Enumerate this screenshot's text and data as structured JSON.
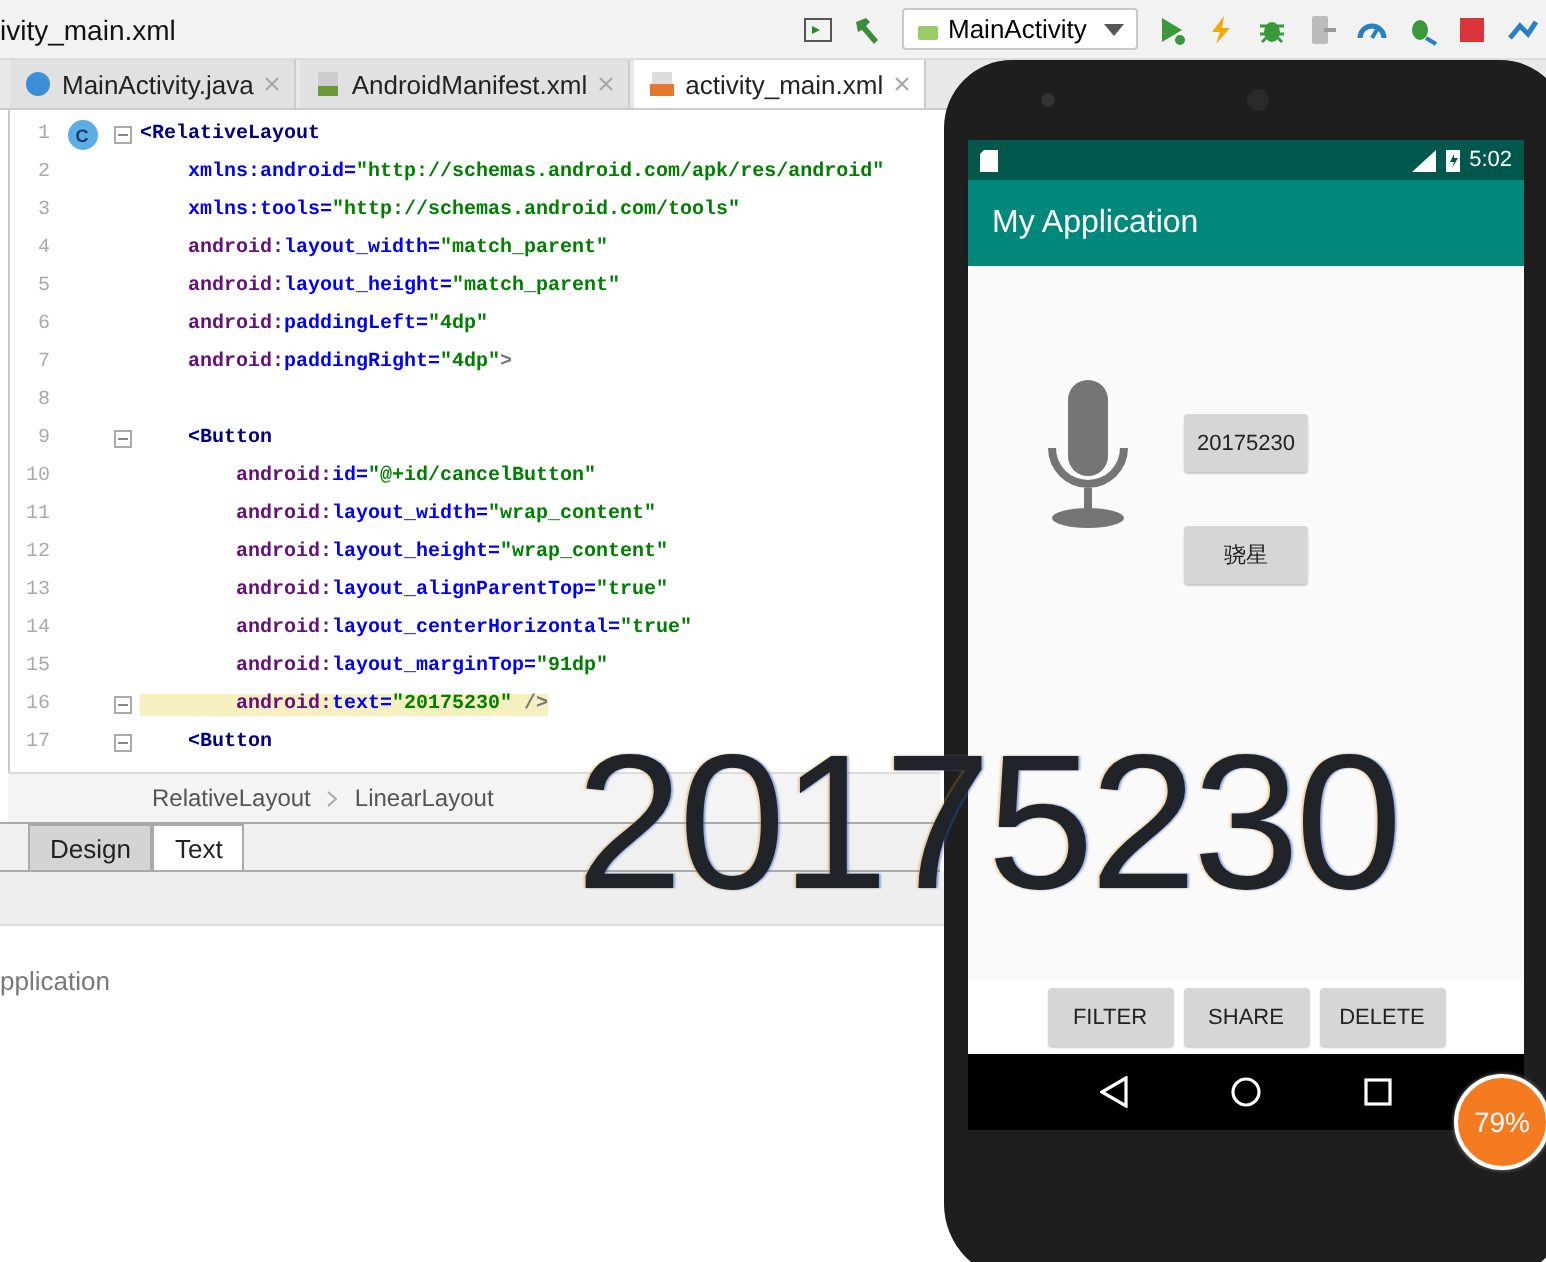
{
  "window": {
    "title": "ivity_main.xml"
  },
  "toolbar": {
    "run_config": "MainActivity"
  },
  "editor_tabs": [
    {
      "label": "MainActivity.java",
      "kind": "java",
      "selected": false
    },
    {
      "label": "AndroidManifest.xml",
      "kind": "manifest",
      "selected": false
    },
    {
      "label": "activity_main.xml",
      "kind": "layout",
      "selected": true
    }
  ],
  "editor": {
    "lines": [
      {
        "number": "1",
        "badge": "C",
        "fold": true,
        "highlighted": false,
        "segments": [
          {
            "kind": "tag",
            "text": "<RelativeLayout"
          }
        ]
      },
      {
        "number": "2",
        "fold": false,
        "highlighted": false,
        "segments": [
          {
            "kind": "attr",
            "text": "    xmlns:android="
          },
          {
            "kind": "value",
            "text": "\"http://schemas.android.com/apk/res/android\""
          }
        ]
      },
      {
        "number": "3",
        "fold": false,
        "highlighted": false,
        "segments": [
          {
            "kind": "attr",
            "text": "    xmlns:tools="
          },
          {
            "kind": "value",
            "text": "\"http://schemas.android.com/tools\""
          }
        ]
      },
      {
        "number": "4",
        "fold": false,
        "highlighted": false,
        "segments": [
          {
            "kind": "ns",
            "text": "    android:"
          },
          {
            "kind": "attr",
            "text": "layout_width="
          },
          {
            "kind": "value",
            "text": "\"match_parent\""
          }
        ]
      },
      {
        "number": "5",
        "fold": false,
        "highlighted": false,
        "segments": [
          {
            "kind": "ns",
            "text": "    android:"
          },
          {
            "kind": "attr",
            "text": "layout_height="
          },
          {
            "kind": "value",
            "text": "\"match_parent\""
          }
        ]
      },
      {
        "number": "6",
        "fold": false,
        "highlighted": false,
        "segments": [
          {
            "kind": "ns",
            "text": "    android:"
          },
          {
            "kind": "attr",
            "text": "paddingLeft="
          },
          {
            "kind": "value",
            "text": "\"4dp\""
          }
        ]
      },
      {
        "number": "7",
        "fold": false,
        "highlighted": false,
        "segments": [
          {
            "kind": "ns",
            "text": "    android:"
          },
          {
            "kind": "attr",
            "text": "paddingRight="
          },
          {
            "kind": "value",
            "text": "\"4dp\""
          },
          {
            "kind": "punct",
            "text": ">"
          }
        ]
      },
      {
        "number": "8",
        "fold": false
      },
      {
        "number": "9",
        "fold": true,
        "highlighted": false,
        "segments": [
          {
            "kind": "tag",
            "text": "    <Button"
          }
        ]
      },
      {
        "number": "10",
        "fold": false,
        "highlighted": false,
        "segments": [
          {
            "kind": "ns",
            "text": "        android:"
          },
          {
            "kind": "attr",
            "text": "id="
          },
          {
            "kind": "value",
            "text": "\"@+id/cancelButton\""
          }
        ]
      },
      {
        "number": "11",
        "fold": false,
        "highlighted": false,
        "segments": [
          {
            "kind": "ns",
            "text": "        android:"
          },
          {
            "kind": "attr",
            "text": "layout_width="
          },
          {
            "kind": "value",
            "text": "\"wrap_content\""
          }
        ]
      },
      {
        "number": "12",
        "fold": false,
        "highlighted": false,
        "segments": [
          {
            "kind": "ns",
            "text": "        android:"
          },
          {
            "kind": "attr",
            "text": "layout_height="
          },
          {
            "kind": "value",
            "text": "\"wrap_content\""
          }
        ]
      },
      {
        "number": "13",
        "fold": false,
        "highlighted": false,
        "segments": [
          {
            "kind": "ns",
            "text": "        android:"
          },
          {
            "kind": "attr",
            "text": "layout_alignParentTop="
          },
          {
            "kind": "value",
            "text": "\"true\""
          }
        ]
      },
      {
        "number": "14",
        "fold": false,
        "highlighted": false,
        "segments": [
          {
            "kind": "ns",
            "text": "        android:"
          },
          {
            "kind": "attr",
            "text": "layout_centerHorizontal="
          },
          {
            "kind": "value",
            "text": "\"true\""
          }
        ]
      },
      {
        "number": "15",
        "fold": false,
        "highlighted": false,
        "segments": [
          {
            "kind": "ns",
            "text": "        android:"
          },
          {
            "kind": "attr",
            "text": "layout_marginTop="
          },
          {
            "kind": "value",
            "text": "\"91dp\""
          }
        ]
      },
      {
        "number": "16",
        "fold": true,
        "highlighted": true,
        "segments": [
          {
            "kind": "ns",
            "text": "        android:"
          },
          {
            "kind": "attr",
            "text": "text="
          },
          {
            "kind": "value",
            "text": "\"20175230\""
          },
          {
            "kind": "punct",
            "text": " />"
          }
        ]
      },
      {
        "number": "17",
        "fold": true,
        "highlighted": false,
        "segments": [
          {
            "kind": "tag",
            "text": "    <Button"
          }
        ]
      }
    ]
  },
  "breadcrumb": [
    "RelativeLayout",
    "LinearLayout"
  ],
  "view_tabs": [
    {
      "label": "Design",
      "selected": false
    },
    {
      "label": "Text",
      "selected": true
    }
  ],
  "project_panel": {
    "text": "pplication"
  },
  "emulator": {
    "time": "5:02",
    "app_title": "My Application",
    "buttons": [
      "20175230",
      "骁星"
    ],
    "bottom_buttons": [
      "FILTER",
      "SHARE",
      "DELETE"
    ]
  },
  "magnified_text": "20175230",
  "badge": "79%"
}
